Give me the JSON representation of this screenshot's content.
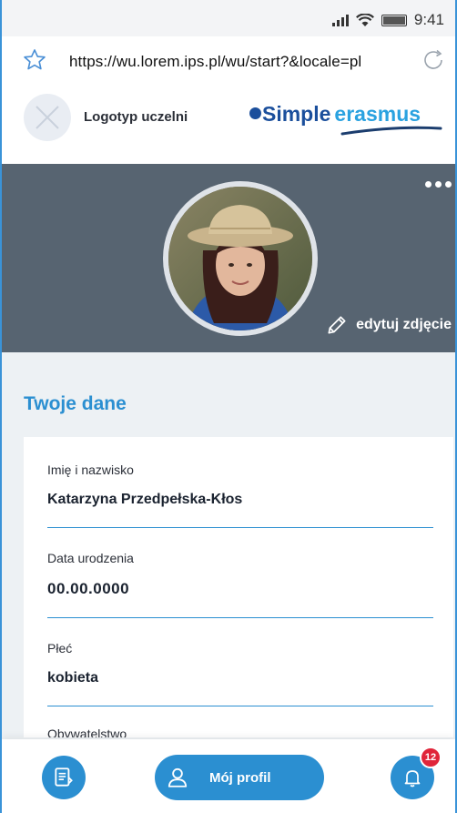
{
  "status": {
    "time": "9:41"
  },
  "browser": {
    "url": "https://wu.lorem.ips.pl/wu/start?&locale=pl"
  },
  "header": {
    "university_logo_label": "Logotyp uczelni",
    "brand": {
      "part1": "Simple",
      "part2": "erasmus"
    }
  },
  "profile": {
    "edit_photo_label": "edytuj zdjęcie"
  },
  "section": {
    "title": "Twoje dane"
  },
  "fields": [
    {
      "label": "Imię i nazwisko",
      "value": "Katarzyna Przedpełska-Kłos"
    },
    {
      "label": "Data urodzenia",
      "value": "00.00.0000"
    },
    {
      "label": "Płeć",
      "value": "kobieta"
    },
    {
      "label": "Obywatelstwo",
      "value": ""
    }
  ],
  "nav": {
    "profile_label": "Mój profil",
    "notifications_count": "12"
  },
  "colors": {
    "accent": "#2b8fd1",
    "hero": "#576471",
    "badge": "#e0253a",
    "brand_dark": "#1b4f9c",
    "brand_light": "#2aa2e0"
  },
  "icons": [
    "star-icon",
    "reload-icon",
    "more-icon",
    "pencil-icon",
    "document-icon",
    "user-icon",
    "bell-icon"
  ]
}
